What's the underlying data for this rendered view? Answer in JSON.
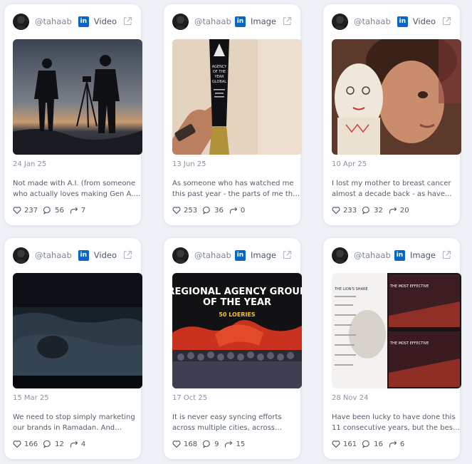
{
  "posts": [
    {
      "handle": "@tahaab",
      "network": "in",
      "type": "Video",
      "date": "24 Jan 25",
      "text": "Not made with A.I. (from someone who actually loves making Gen A.I. films)...",
      "likes": "237",
      "comments": "56",
      "shares": "7"
    },
    {
      "handle": "@tahaab",
      "network": "in",
      "type": "Image",
      "date": "13 Jun 25",
      "text": "As someone who has watched me this past year - the parts of me that the...",
      "likes": "253",
      "comments": "36",
      "shares": "0",
      "image_text": {
        "l1": "AGENCY",
        "l2": "OF THE",
        "l3": "YEAR",
        "l4": "GLOBAL"
      }
    },
    {
      "handle": "@tahaab",
      "network": "in",
      "type": "Video",
      "date": "10 Apr 25",
      "text": "I lost my mother to breast cancer almost a decade back - as have...",
      "likes": "233",
      "comments": "32",
      "shares": "20"
    },
    {
      "handle": "@tahaab",
      "network": "in",
      "type": "Video",
      "date": "15 Mar 25",
      "text": "We need to stop simply marketing our brands in Ramadan. And instead...",
      "likes": "166",
      "comments": "12",
      "shares": "4"
    },
    {
      "handle": "@tahaab",
      "network": "in",
      "type": "Image",
      "date": "17 Oct 25",
      "text": "It is never easy syncing efforts across multiple cities, across multiple...",
      "likes": "168",
      "comments": "9",
      "shares": "15",
      "image_text": {
        "l1": "REGIONAL AGENCY GROUP",
        "l2": "OF THE YEAR",
        "l3": "50 LOERIES"
      }
    },
    {
      "handle": "@tahaab",
      "network": "in",
      "type": "Image",
      "date": "28 Nov 24",
      "text": "Have been lucky to have done this 11 consecutive years, but the best ones...",
      "likes": "161",
      "comments": "16",
      "shares": "6",
      "image_text": {
        "l1": "THE LION'S SHARE",
        "l2": "THE MOST EFFECTIVE",
        "l3": "THE MOST EFFECTIVE"
      }
    }
  ],
  "colors": {
    "linkedin": "#0a66c2",
    "card": "#ffffff",
    "background": "#eef1f6"
  }
}
